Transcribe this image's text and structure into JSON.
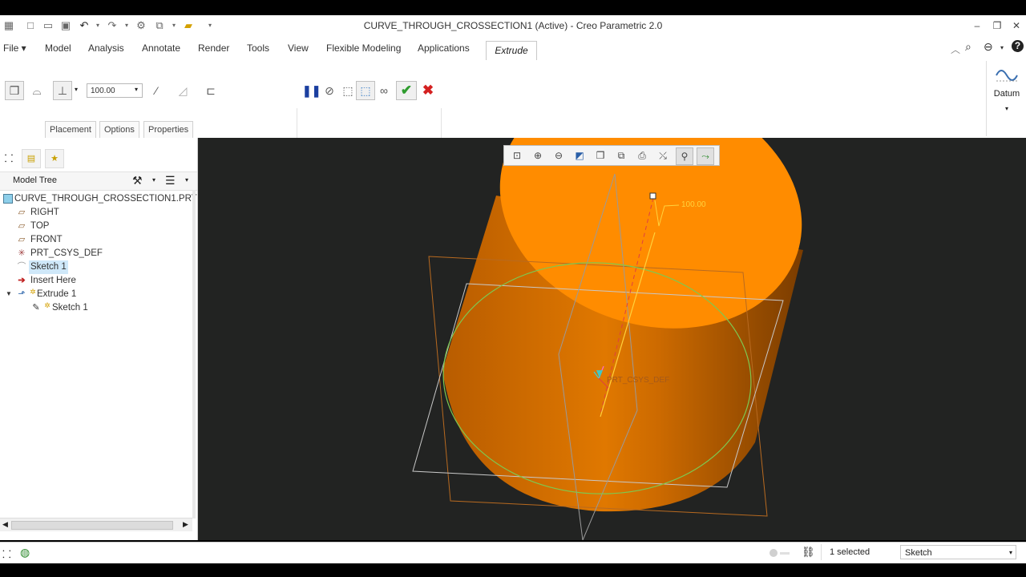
{
  "window": {
    "title": "CURVE_THROUGH_CROSSECTION1 (Active) - Creo Parametric 2.0"
  },
  "menu": {
    "file": "File",
    "tabs": [
      "Model",
      "Analysis",
      "Annotate",
      "Render",
      "Tools",
      "View",
      "Flexible Modeling",
      "Applications"
    ],
    "active_tab": "Extrude"
  },
  "ribbon": {
    "depth_value": "100.00",
    "subtabs": [
      "Placement",
      "Options",
      "Properties"
    ],
    "datum_label": "Datum"
  },
  "tree": {
    "header": "Model Tree",
    "items": [
      {
        "label": "CURVE_THROUGH_CROSSECTION1.PRT",
        "icon": "part-icon"
      },
      {
        "label": "RIGHT",
        "icon": "datum-plane-icon"
      },
      {
        "label": "TOP",
        "icon": "datum-plane-icon"
      },
      {
        "label": "FRONT",
        "icon": "datum-plane-icon"
      },
      {
        "label": "PRT_CSYS_DEF",
        "icon": "csys-icon"
      },
      {
        "label": "Sketch 1",
        "icon": "sketch-icon"
      },
      {
        "label": "Insert Here",
        "icon": "insert-arrow-icon"
      },
      {
        "label": "Extrude 1",
        "icon": "extrude-icon"
      },
      {
        "label": "Sketch 1",
        "icon": "sketch-icon"
      }
    ]
  },
  "viewport": {
    "dimension_label": "100.00",
    "csys_label": "PRT_CSYS_DEF"
  },
  "status": {
    "selection_count": "1 selected",
    "filter_value": "Sketch"
  },
  "colors": {
    "accent_orange": "#ff8c00",
    "viewport_bg": "#222322",
    "confirm_green": "#2e9c2e",
    "cancel_red": "#d42020"
  }
}
